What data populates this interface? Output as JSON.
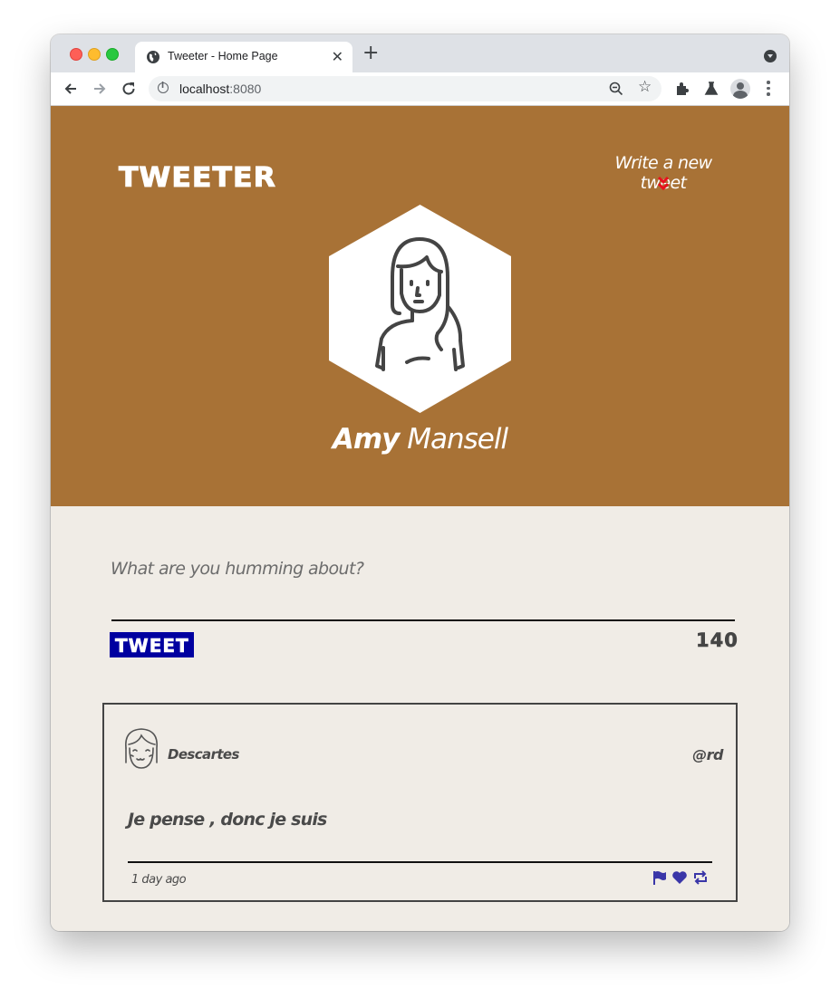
{
  "browser": {
    "tab_title": "Tweeter - Home Page",
    "tab_close": "✕",
    "new_tab": "+",
    "url_host": "localhost",
    "url_port": ":8080"
  },
  "header": {
    "logo": "TWEETER",
    "write_link": "Write a new tweet",
    "user_first": "Amy",
    "user_last": "Mansell",
    "chevron_color": "#e8101c",
    "background_color": "#a87236"
  },
  "composer": {
    "placeholder": "What are you humming about?",
    "button_label": "TWEET",
    "counter": "140",
    "button_color": "#0000a0"
  },
  "tweets": [
    {
      "name": "Descartes",
      "handle": "@rd",
      "content": "Je pense , donc je suis",
      "time": "1 day ago",
      "actions": [
        "flag-icon",
        "heart-icon",
        "retweet-icon"
      ],
      "action_color": "#3a36a8"
    }
  ]
}
